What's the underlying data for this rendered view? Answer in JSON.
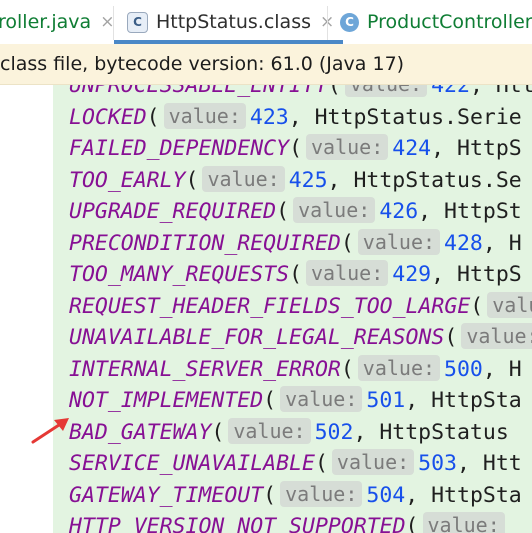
{
  "tabs": [
    {
      "name": "roller.java",
      "close": "×",
      "type": "java",
      "active": false
    },
    {
      "name": "HttpStatus.class",
      "close": "×",
      "type": "class",
      "active": true,
      "icon_text": "C"
    },
    {
      "name": "ProductController.j",
      "close": "",
      "type": "java",
      "active": false,
      "icon_text": "C"
    }
  ],
  "banner": {
    "text": "class file, bytecode version: 61.0 (Java 17)"
  },
  "hint_label": "value:",
  "lines": [
    {
      "name": "UNPROCESSABLE_ENTITY",
      "value": "422",
      "rest": "HttpStatus.Serie"
    },
    {
      "name": "LOCKED",
      "value": "423",
      "rest": "HttpStatus.Serie"
    },
    {
      "name": "FAILED_DEPENDENCY",
      "value": "424",
      "rest": "HttpS"
    },
    {
      "name": "TOO_EARLY",
      "value": "425",
      "rest": "HttpStatus.Se"
    },
    {
      "name": "UPGRADE_REQUIRED",
      "value": "426",
      "rest": "HttpSt"
    },
    {
      "name": "PRECONDITION_REQUIRED",
      "value": "428",
      "rest": "H"
    },
    {
      "name": "TOO_MANY_REQUESTS",
      "value": "429",
      "rest": "HttpS"
    },
    {
      "name": "REQUEST_HEADER_FIELDS_TOO_LARGE",
      "value": "",
      "rest": ""
    },
    {
      "name": "UNAVAILABLE_FOR_LEGAL_REASONS",
      "value": "",
      "rest": ""
    },
    {
      "name": "INTERNAL_SERVER_ERROR",
      "value": "500",
      "rest": "H"
    },
    {
      "name": "NOT_IMPLEMENTED",
      "value": "501",
      "rest": "HttpSta"
    },
    {
      "name": "BAD_GATEWAY",
      "value": "502",
      "rest": "HttpStatus"
    },
    {
      "name": "SERVICE_UNAVAILABLE",
      "value": "503",
      "rest": "Htt"
    },
    {
      "name": "GATEWAY_TIMEOUT",
      "value": "504",
      "rest": "HttpSta"
    },
    {
      "name": "HTTP_VERSION_NOT_SUPPORTED",
      "value": "",
      "rest": ""
    }
  ],
  "colors": {
    "constant": "#871094",
    "number": "#1750eb",
    "editor_bg": "#e3f4e1",
    "banner_bg": "#fbf3dc",
    "arrow": "#e53935",
    "active_tab_underline": "#4a88c7"
  },
  "annotation": {
    "icon": "red-arrow-icon"
  }
}
